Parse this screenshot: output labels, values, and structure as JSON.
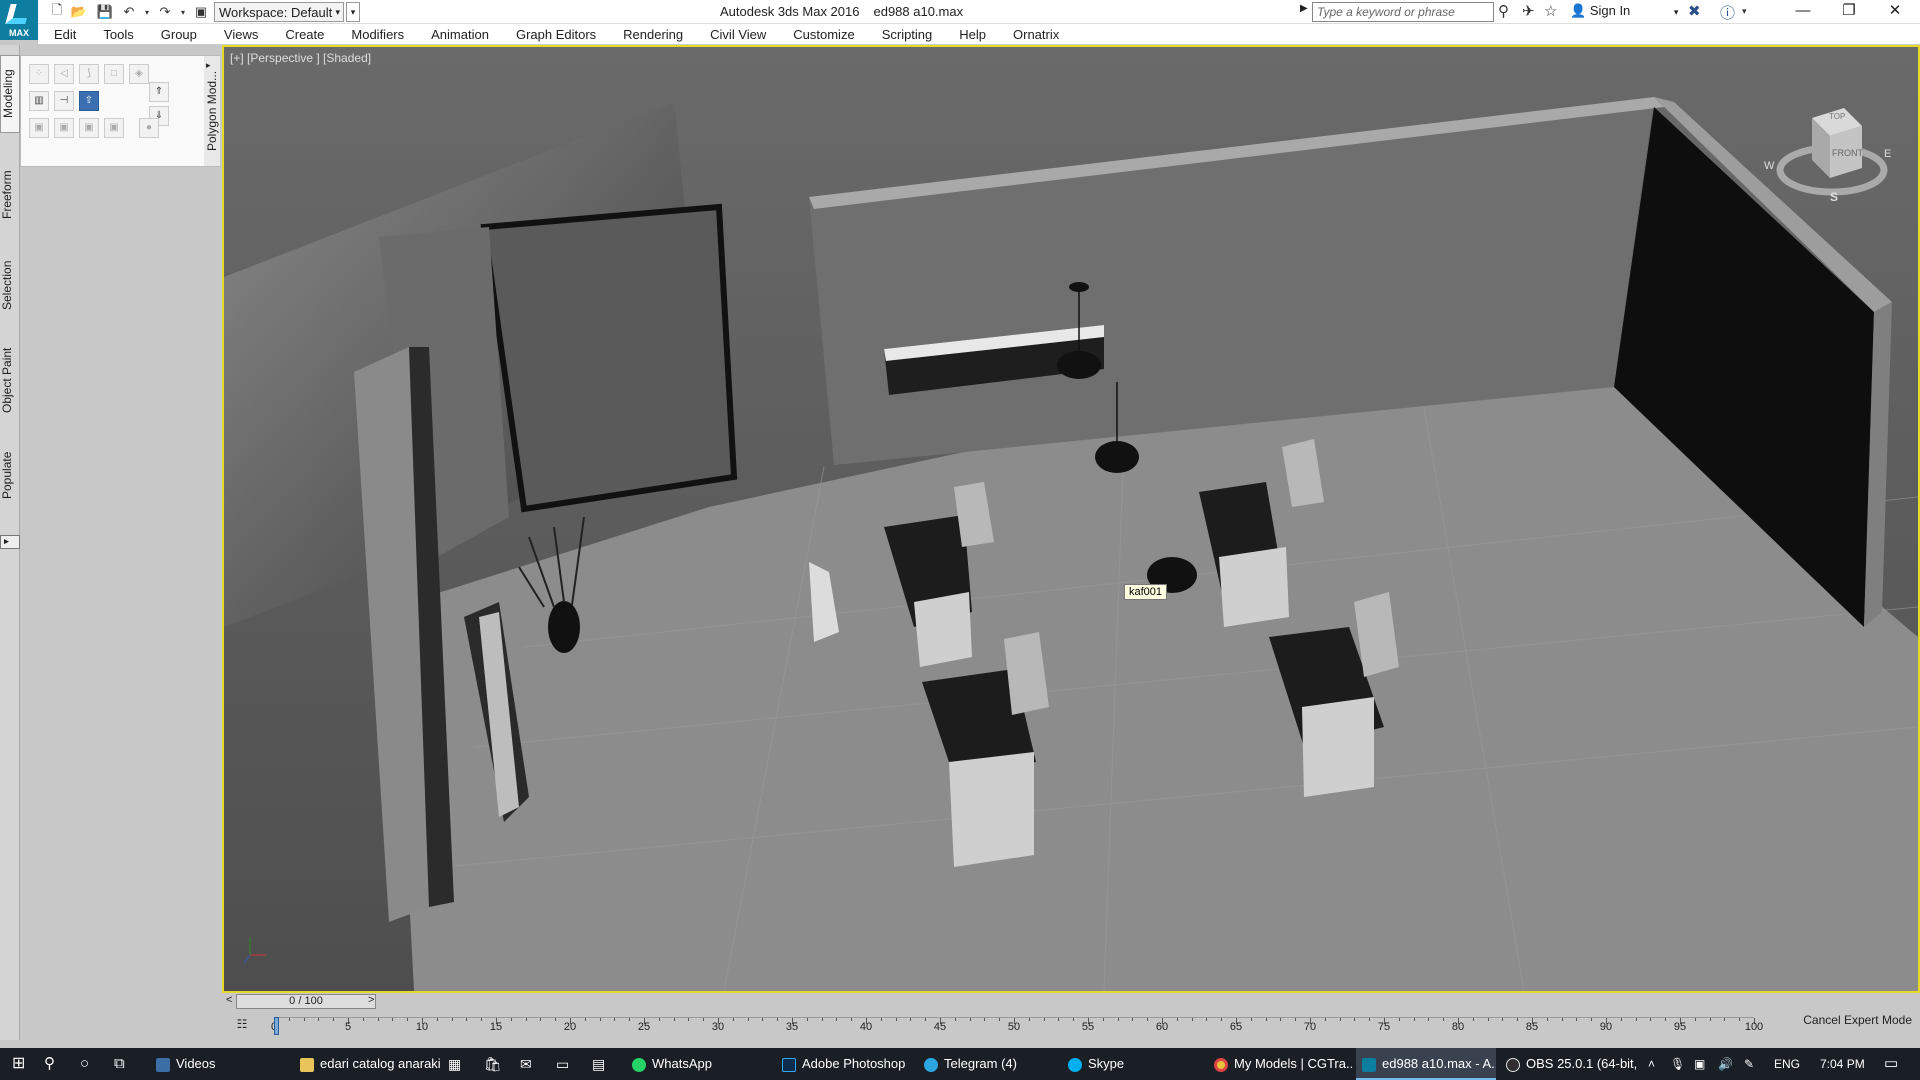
{
  "app": {
    "logo_text": "MAX",
    "title": "Autodesk 3ds Max 2016",
    "file": "ed988 a10.max"
  },
  "workspace": {
    "label": "Workspace: Default"
  },
  "search": {
    "placeholder": "Type a keyword or phrase"
  },
  "account": {
    "sign_in": "Sign In"
  },
  "menu": [
    "Edit",
    "Tools",
    "Group",
    "Views",
    "Create",
    "Modifiers",
    "Animation",
    "Graph Editors",
    "Rendering",
    "Civil View",
    "Customize",
    "Scripting",
    "Help",
    "Ornatrix"
  ],
  "ribbon_tabs": [
    "Modeling",
    "Freeform",
    "Selection",
    "Object Paint",
    "Populate"
  ],
  "panel": {
    "tab": "Polygon Mod..."
  },
  "viewport": {
    "label": "[+] [Perspective ] [Shaded]",
    "tooltip": "kaf001",
    "viewcube": {
      "top": "TOP",
      "front": "FRONT",
      "w": "W",
      "e": "E",
      "s": "S"
    }
  },
  "timeline": {
    "frame": "0 / 100",
    "prev": "<",
    "next": ">",
    "ticks": [
      "0",
      "5",
      "10",
      "15",
      "20",
      "25",
      "30",
      "35",
      "40",
      "45",
      "50",
      "55",
      "60",
      "65",
      "70",
      "75",
      "80",
      "85",
      "90",
      "95",
      "100"
    ],
    "cancel_expert": "Cancel Expert Mode"
  },
  "taskbar": {
    "items": [
      "Videos",
      "edari catalog anaraki",
      "WhatsApp",
      "Adobe Photoshop ...",
      "Telegram (4)",
      "Skype",
      "My Models | CGTra...",
      "ed988 a10.max - A...",
      "OBS 25.0.1 (64-bit, ..."
    ],
    "lang": "ENG",
    "time": "7:04 PM"
  },
  "colors": {
    "viewport_border": "#e6d92a",
    "taskbar": "#1a1f26",
    "accent": "#0d7ea0"
  }
}
